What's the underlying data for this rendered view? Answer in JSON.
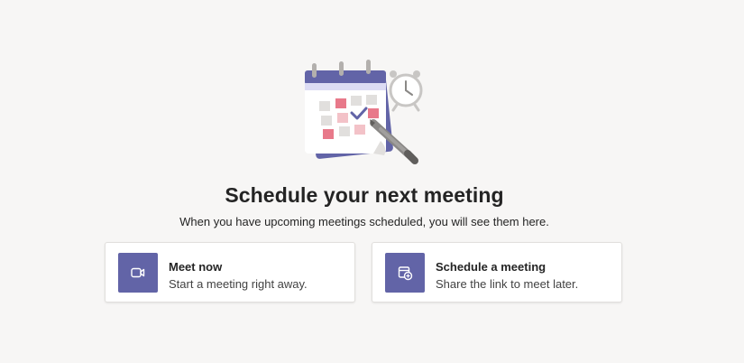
{
  "empty_state": {
    "illustration_icon": "calendar-with-clock-and-pen-illustration",
    "title": "Schedule your next meeting",
    "subtitle": "When you have upcoming meetings scheduled, you will see them here."
  },
  "actions": [
    {
      "icon": "video-camera-icon",
      "title": "Meet now",
      "description": "Start a meeting right away."
    },
    {
      "icon": "calendar-add-icon",
      "title": "Schedule a meeting",
      "description": "Share the link to meet later."
    }
  ],
  "colors": {
    "accent": "#6264a7",
    "background": "#f7f6f5",
    "card": "#ffffff",
    "calendar_highlight": "#e8798a"
  }
}
